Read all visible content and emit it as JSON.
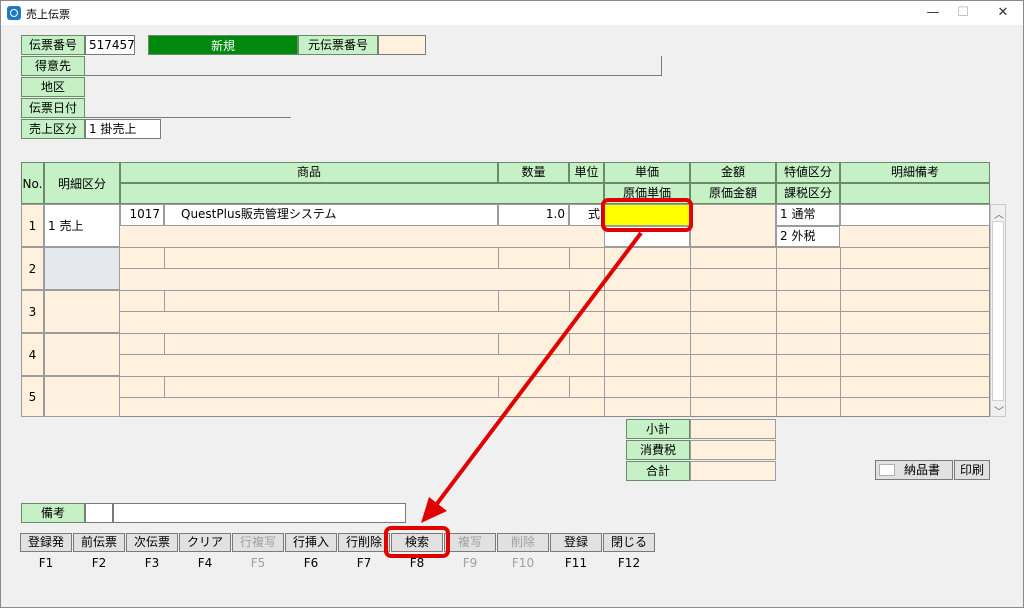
{
  "window": {
    "title": "売上伝票",
    "min": "—",
    "max": "☐",
    "close": "✕"
  },
  "header": {
    "denpyo_label": "伝票番号",
    "denpyo_value": "517457",
    "mode_label": "新規",
    "moto_label": "元伝票番号",
    "moto_value": "",
    "tokuisaki_label": "得意先",
    "chiku_label": "地区",
    "date_label": "伝票日付",
    "uriage_label": "売上区分",
    "uriage_value": "1 掛売上"
  },
  "table": {
    "headers": {
      "no": "No.",
      "meisai": "明細区分",
      "shohin": "商品",
      "suryo": "数量",
      "tani": "単位",
      "tanka": "単価",
      "kingaku": "金額",
      "tokuchi": "特値区分",
      "biko": "明細備考",
      "genka_tanka": "原価単価",
      "genka_kingaku": "原価金額",
      "kazei": "課税区分"
    },
    "rows": [
      {
        "no": "1",
        "kubun": "1 売上",
        "code": "1017",
        "name": "QuestPlus販売管理システム",
        "qty": "1.0",
        "unit": "式",
        "tokuchi": "1 通常",
        "kazei": "2 外税"
      },
      {
        "no": "2"
      },
      {
        "no": "3"
      },
      {
        "no": "4"
      },
      {
        "no": "5"
      }
    ]
  },
  "totals": {
    "subtotal": "小計",
    "tax": "消費税",
    "total": "合計"
  },
  "print": {
    "nohin": "納品書",
    "insatsu": "印刷"
  },
  "biko_label": "備考",
  "fkeys": [
    {
      "label": "登録発",
      "key": "F1",
      "enabled": true
    },
    {
      "label": "前伝票",
      "key": "F2",
      "enabled": true
    },
    {
      "label": "次伝票",
      "key": "F3",
      "enabled": true
    },
    {
      "label": "クリア",
      "key": "F4",
      "enabled": true
    },
    {
      "label": "行複写",
      "key": "F5",
      "enabled": false
    },
    {
      "label": "行挿入",
      "key": "F6",
      "enabled": true
    },
    {
      "label": "行削除",
      "key": "F7",
      "enabled": true
    },
    {
      "label": "検索",
      "key": "F8",
      "enabled": true
    },
    {
      "label": "複写",
      "key": "F9",
      "enabled": false
    },
    {
      "label": "削除",
      "key": "F10",
      "enabled": false
    },
    {
      "label": "登録",
      "key": "F11",
      "enabled": true
    },
    {
      "label": "閉じる",
      "key": "F12",
      "enabled": true
    }
  ],
  "colors": {
    "label_green": "#c6f0c6",
    "mode_green": "#00870e",
    "highlight_yellow": "#ffff00",
    "annotation_red": "#e00000",
    "peach": "#fff1dd"
  },
  "icons": {
    "app": "app-icon",
    "scroll_up": "chevron-up-icon",
    "scroll_down": "chevron-down-icon"
  }
}
